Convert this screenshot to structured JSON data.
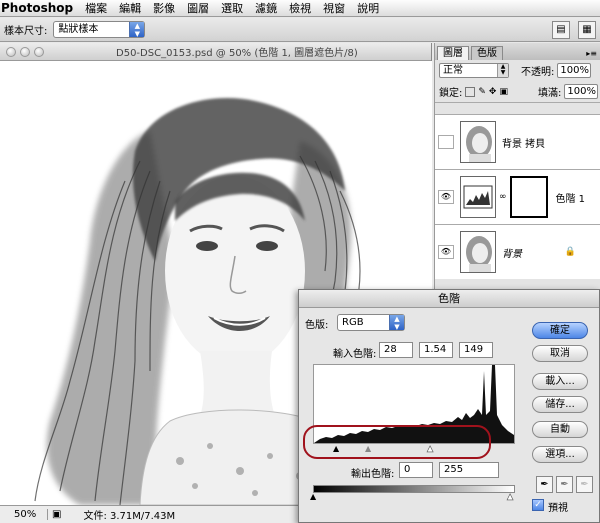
{
  "menubar": {
    "app": "Photoshop",
    "items": [
      "檔案",
      "編輯",
      "影像",
      "圖層",
      "選取",
      "濾鏡",
      "檢視",
      "視窗",
      "說明"
    ]
  },
  "options": {
    "label": "樣本尺寸:",
    "sample_size": "點狀樣本"
  },
  "document": {
    "title": "D50-DSC_0153.psd @ 50% (色階 1, 圖層遮色片/8)",
    "zoom": "50%",
    "file_info": "文件: 3.71M/7.43M"
  },
  "layers_panel": {
    "tabs": [
      "圖層",
      "色版"
    ],
    "blend_mode": "正常",
    "opacity_label": "不透明:",
    "opacity": "100%",
    "lock_label": "鎖定:",
    "fill_label": "填滿:",
    "fill": "100%",
    "layers": [
      {
        "name": "背景 拷貝",
        "visible": false
      },
      {
        "name": "色階 1",
        "visible": true
      },
      {
        "name": "背景",
        "visible": true
      }
    ]
  },
  "levels_dialog": {
    "title": "色階",
    "channel_label": "色版:",
    "channel": "RGB",
    "input_label": "輸入色階:",
    "input_black": "28",
    "input_gamma": "1.54",
    "input_white": "149",
    "output_label": "輸出色階:",
    "output_black": "0",
    "output_white": "255",
    "buttons": {
      "ok": "確定",
      "cancel": "取消",
      "load": "載入...",
      "save": "儲存...",
      "auto": "自動",
      "options": "選項..."
    },
    "preview_label": "預視",
    "preview_checked": true,
    "highlight_color": "#a0121c"
  }
}
